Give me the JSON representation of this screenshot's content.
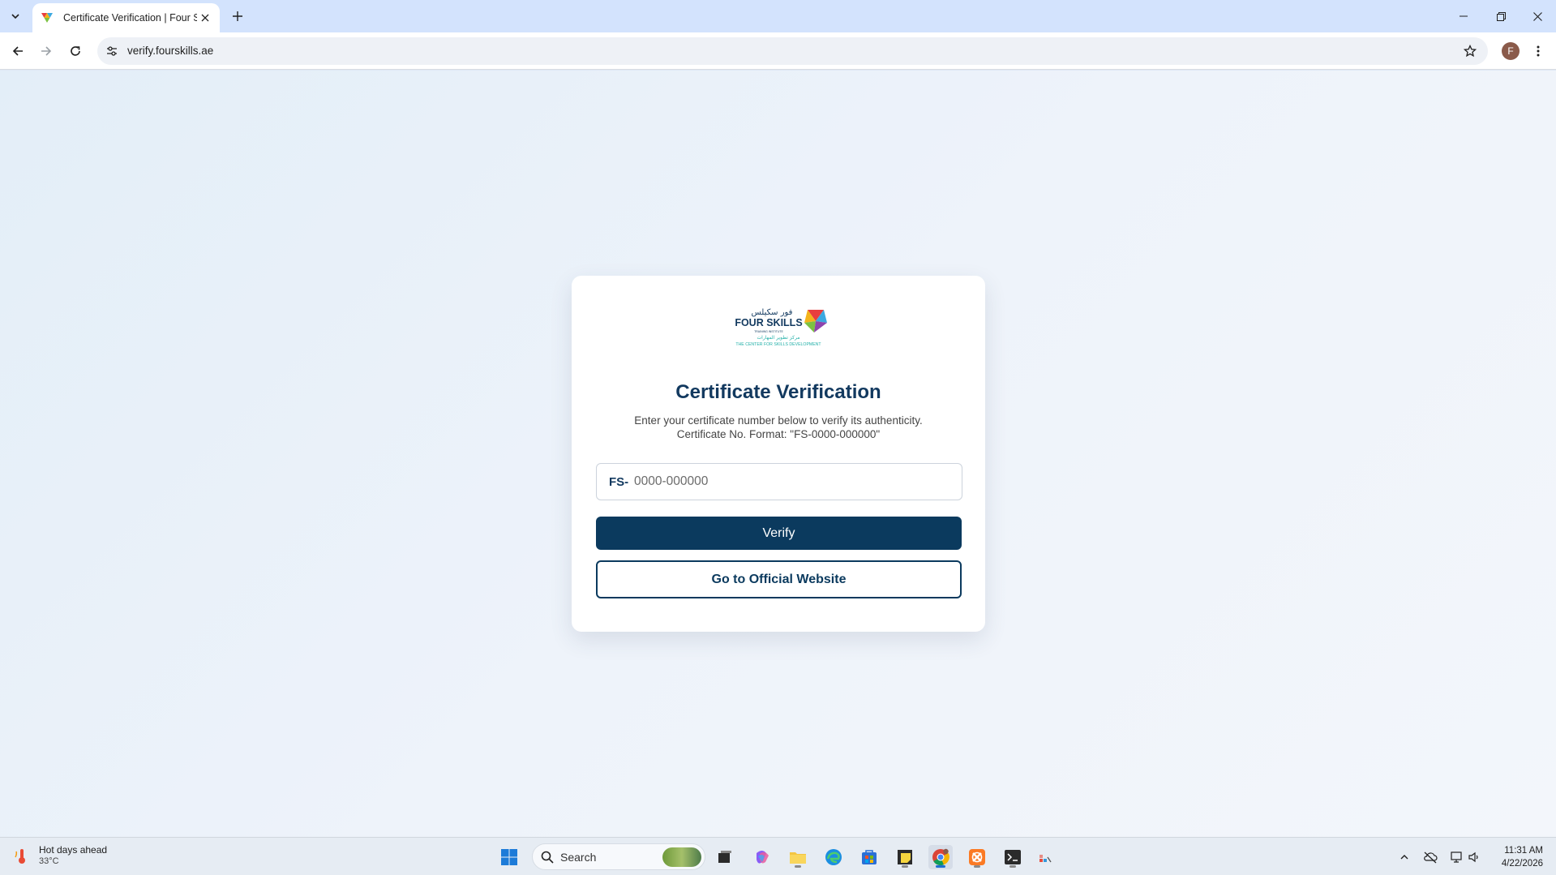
{
  "browser": {
    "tab_title": "Certificate Verification | Four Skills",
    "url": "verify.fourskills.ae",
    "avatar_letter": "F"
  },
  "logo": {
    "arabic_text": "فور سكيلس",
    "english_text": "FOUR SKILLS",
    "tagline": "THE CENTER FOR SKILLS DEVELOPMENT"
  },
  "card": {
    "title": "Certificate Verification",
    "description_line1": "Enter your certificate number below to verify its authenticity.",
    "description_line2": "Certificate No. Format: \"FS-0000-000000\"",
    "input_prefix": "FS-",
    "input_placeholder": "0000-000000",
    "input_value": "",
    "verify_label": "Verify",
    "official_label": "Go to Official Website"
  },
  "taskbar": {
    "weather_title": "Hot days ahead",
    "weather_temp": "33°C",
    "search_label": "Search",
    "time": "11:31 AM",
    "date": "4/22/2026"
  },
  "colors": {
    "primary": "#0b3a5e",
    "title": "#12395f",
    "page_bg": "#e3eef8"
  }
}
